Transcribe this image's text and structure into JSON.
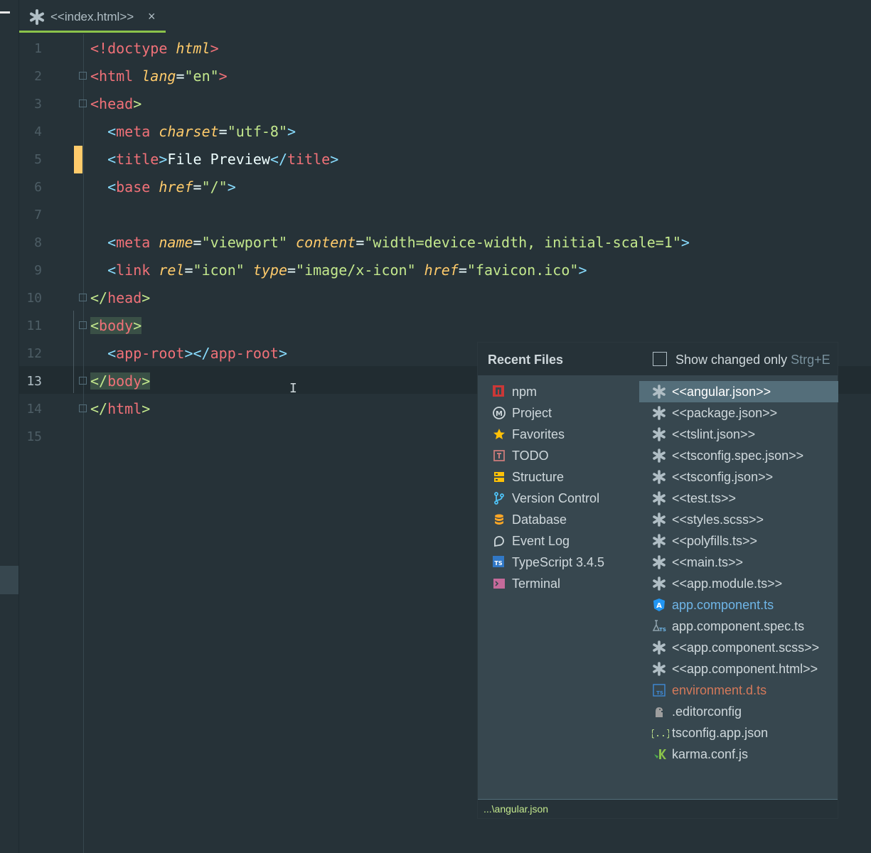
{
  "tab": {
    "label": "<<index.html>>",
    "close": "×"
  },
  "code_lines": [
    {
      "n": "1",
      "parts": [
        [
          "<!doctype ",
          "t-tag"
        ],
        [
          "html",
          "t-attr"
        ],
        [
          ">",
          "t-tag"
        ]
      ]
    },
    {
      "n": "2",
      "parts": [
        [
          "<",
          "t-tag"
        ],
        [
          "html ",
          "t-tag"
        ],
        [
          "lang",
          "t-attr"
        ],
        [
          "=",
          "t-txt"
        ],
        [
          "\"en\"",
          "t-str"
        ],
        [
          ">",
          "t-tag"
        ]
      ]
    },
    {
      "n": "3",
      "parts": [
        [
          "<",
          "t-tag"
        ],
        [
          "head",
          "t-tag"
        ],
        [
          ">",
          "t-str"
        ]
      ]
    },
    {
      "n": "4",
      "parts": [
        [
          "  ",
          "t-txt"
        ],
        [
          "<",
          "t-br"
        ],
        [
          "meta ",
          "t-tag"
        ],
        [
          "charset",
          "t-attr"
        ],
        [
          "=",
          "t-txt"
        ],
        [
          "\"utf-8\"",
          "t-str"
        ],
        [
          ">",
          "t-br"
        ]
      ]
    },
    {
      "n": "5",
      "parts": [
        [
          "  ",
          "t-txt"
        ],
        [
          "<",
          "t-br"
        ],
        [
          "title",
          "t-tag"
        ],
        [
          ">",
          "t-br"
        ],
        [
          "File Preview",
          "t-txt"
        ],
        [
          "</",
          "t-br"
        ],
        [
          "title",
          "t-tag"
        ],
        [
          ">",
          "t-br"
        ]
      ]
    },
    {
      "n": "6",
      "parts": [
        [
          "  ",
          "t-txt"
        ],
        [
          "<",
          "t-br"
        ],
        [
          "base ",
          "t-tag"
        ],
        [
          "href",
          "t-attr"
        ],
        [
          "=",
          "t-txt"
        ],
        [
          "\"/\"",
          "t-str"
        ],
        [
          ">",
          "t-br"
        ]
      ]
    },
    {
      "n": "7",
      "parts": []
    },
    {
      "n": "8",
      "parts": [
        [
          "  ",
          "t-txt"
        ],
        [
          "<",
          "t-br"
        ],
        [
          "meta ",
          "t-tag"
        ],
        [
          "name",
          "t-attr"
        ],
        [
          "=",
          "t-txt"
        ],
        [
          "\"viewport\" ",
          "t-str"
        ],
        [
          "content",
          "t-attr"
        ],
        [
          "=",
          "t-txt"
        ],
        [
          "\"width=device-width, initial-scale=1\"",
          "t-str"
        ],
        [
          ">",
          "t-br"
        ]
      ]
    },
    {
      "n": "9",
      "parts": [
        [
          "  ",
          "t-txt"
        ],
        [
          "<",
          "t-br"
        ],
        [
          "link ",
          "t-tag"
        ],
        [
          "rel",
          "t-attr"
        ],
        [
          "=",
          "t-txt"
        ],
        [
          "\"icon\" ",
          "t-str"
        ],
        [
          "type",
          "t-attr"
        ],
        [
          "=",
          "t-txt"
        ],
        [
          "\"image/x-icon\" ",
          "t-str"
        ],
        [
          "href",
          "t-attr"
        ],
        [
          "=",
          "t-txt"
        ],
        [
          "\"favicon.ico\"",
          "t-str"
        ],
        [
          ">",
          "t-br"
        ]
      ]
    },
    {
      "n": "10",
      "parts": [
        [
          "</",
          "t-str"
        ],
        [
          "head",
          "t-tag"
        ],
        [
          ">",
          "t-str"
        ]
      ]
    },
    {
      "n": "11",
      "parts": [
        [
          "<",
          "t-str"
        ],
        [
          "body",
          "t-tag"
        ],
        [
          ">",
          "t-str"
        ]
      ],
      "hl": true
    },
    {
      "n": "12",
      "parts": [
        [
          "  ",
          "t-txt"
        ],
        [
          "<",
          "t-br"
        ],
        [
          "app-root",
          "t-tag"
        ],
        [
          ">",
          "t-br"
        ],
        [
          "</",
          "t-br"
        ],
        [
          "app-root",
          "t-tag"
        ],
        [
          ">",
          "t-br"
        ]
      ]
    },
    {
      "n": "13",
      "parts": [
        [
          "</",
          "t-str"
        ],
        [
          "body",
          "t-tag"
        ],
        [
          ">",
          "t-str"
        ]
      ],
      "hl": true,
      "active": true
    },
    {
      "n": "14",
      "parts": [
        [
          "</",
          "t-str"
        ],
        [
          "html",
          "t-tag"
        ],
        [
          ">",
          "t-str"
        ]
      ]
    },
    {
      "n": "15",
      "parts": []
    }
  ],
  "popup": {
    "title": "Recent Files",
    "show_changed": "Show changed only",
    "shortcut": "Strg+E",
    "footer_path": "...\\angular.json",
    "tool_windows": [
      {
        "label": "npm",
        "icon": "npm-icon"
      },
      {
        "label": "Project",
        "icon": "project-icon"
      },
      {
        "label": "Favorites",
        "icon": "star-icon"
      },
      {
        "label": "TODO",
        "icon": "todo-icon"
      },
      {
        "label": "Structure",
        "icon": "structure-icon"
      },
      {
        "label": "Version Control",
        "icon": "vcs-branch-icon"
      },
      {
        "label": "Database",
        "icon": "database-icon"
      },
      {
        "label": "Event Log",
        "icon": "event-log-icon"
      },
      {
        "label": "TypeScript 3.4.5",
        "icon": "typescript-icon"
      },
      {
        "label": "Terminal",
        "icon": "terminal-icon"
      }
    ],
    "files": [
      {
        "label": "<<angular.json>>",
        "icon": "asterisk-icon",
        "selected": true
      },
      {
        "label": "<<package.json>>",
        "icon": "asterisk-icon"
      },
      {
        "label": "<<tslint.json>>",
        "icon": "asterisk-icon"
      },
      {
        "label": "<<tsconfig.spec.json>>",
        "icon": "asterisk-icon"
      },
      {
        "label": "<<tsconfig.json>>",
        "icon": "asterisk-icon"
      },
      {
        "label": "<<test.ts>>",
        "icon": "asterisk-icon"
      },
      {
        "label": "<<styles.scss>>",
        "icon": "asterisk-icon"
      },
      {
        "label": "<<polyfills.ts>>",
        "icon": "asterisk-icon"
      },
      {
        "label": "<<main.ts>>",
        "icon": "asterisk-icon"
      },
      {
        "label": "<<app.module.ts>>",
        "icon": "asterisk-icon"
      },
      {
        "label": "app.component.ts",
        "icon": "angular-icon",
        "color": "blue"
      },
      {
        "label": "app.component.spec.ts",
        "icon": "spec-ts-icon"
      },
      {
        "label": "<<app.component.scss>>",
        "icon": "asterisk-icon"
      },
      {
        "label": "<<app.component.html>>",
        "icon": "asterisk-icon"
      },
      {
        "label": "environment.d.ts",
        "icon": "ts-file-icon",
        "color": "red"
      },
      {
        "label": ".editorconfig",
        "icon": "editorconfig-icon"
      },
      {
        "label": "tsconfig.app.json",
        "icon": "json-icon"
      },
      {
        "label": "karma.conf.js",
        "icon": "karma-icon"
      }
    ]
  },
  "colors": {
    "accent": "#8bc34a",
    "selection": "#546e7a",
    "change_marker": "#ffcb6b"
  }
}
